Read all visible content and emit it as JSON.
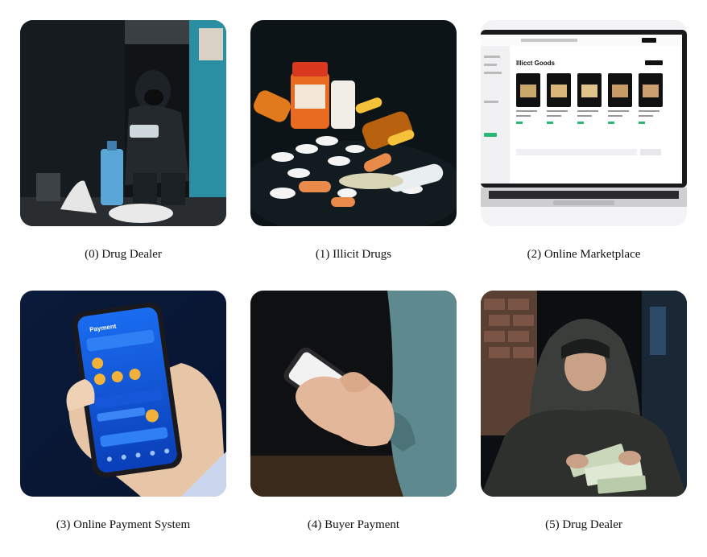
{
  "panels": [
    {
      "caption": "(0) Drug Dealer"
    },
    {
      "caption": "(1) Illicit Drugs"
    },
    {
      "caption": "(2) Online Marketplace",
      "screen_title": "Illicct Goods"
    },
    {
      "caption": "(3) Online Payment System",
      "screen_title": "Payment"
    },
    {
      "caption": "(4) Buyer Payment"
    },
    {
      "caption": "(5) Drug Dealer"
    }
  ]
}
